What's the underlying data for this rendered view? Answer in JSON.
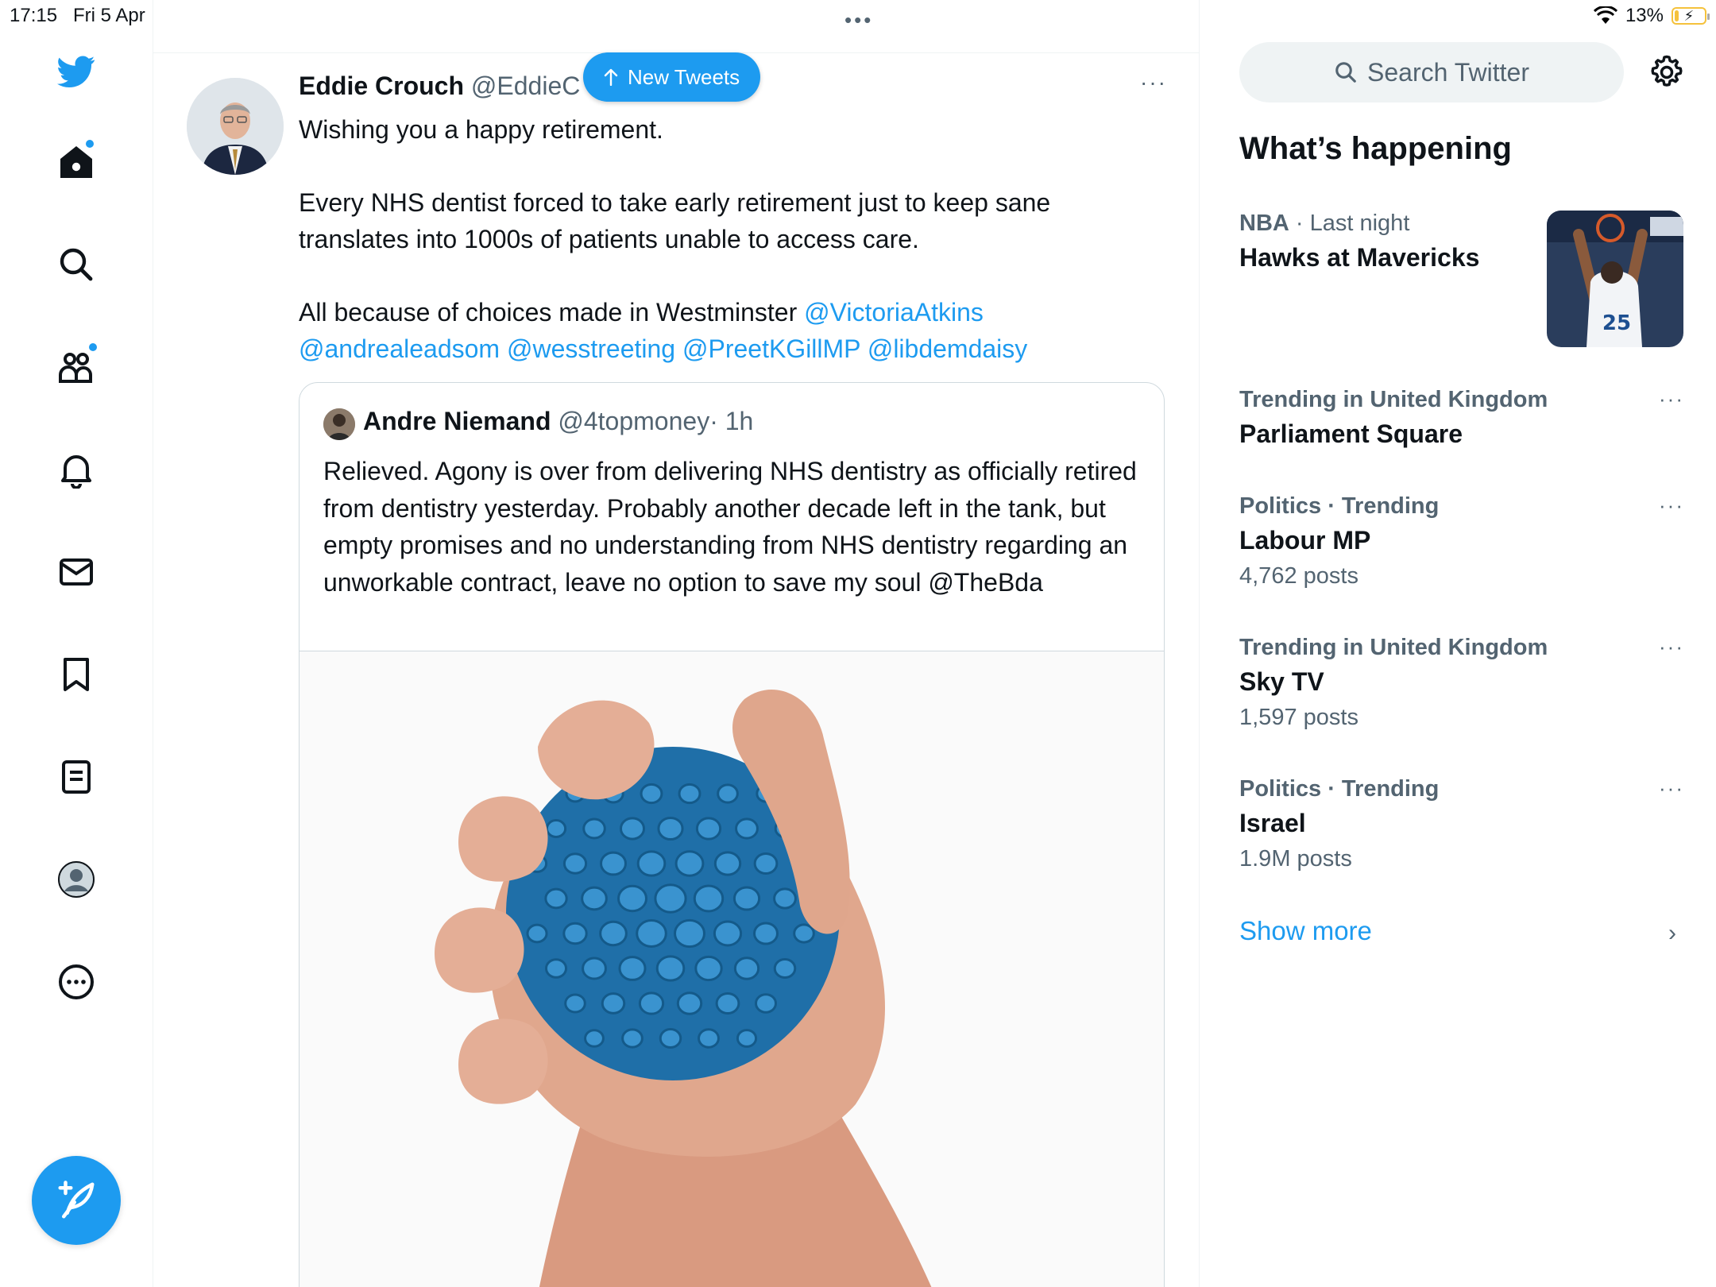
{
  "status": {
    "time": "17:15",
    "date": "Fri 5 Apr",
    "battery": "13%",
    "battery_level_pct": 13
  },
  "sidebar": {
    "items": [
      {
        "icon": "twitter-logo-icon"
      },
      {
        "icon": "home-icon",
        "has_dot": true
      },
      {
        "icon": "search-icon"
      },
      {
        "icon": "communities-icon",
        "has_dot": true
      },
      {
        "icon": "bell-icon"
      },
      {
        "icon": "mail-icon"
      },
      {
        "icon": "bookmark-icon"
      },
      {
        "icon": "lists-icon"
      },
      {
        "icon": "profile-icon"
      },
      {
        "icon": "more-circle-icon"
      }
    ],
    "compose_icon": "compose-feather-icon"
  },
  "main": {
    "top_more": "•••",
    "new_tweets_label": "New Tweets",
    "tweet": {
      "author_name": "Eddie Crouch",
      "author_handle": "@EddieC",
      "more": "···",
      "para1": "Wishing you a happy retirement.",
      "para2": "Every NHS dentist forced to take early retirement just to keep sane translates into 1000s of patients unable to access care.",
      "para3_text": "All because of choices made in Westminster ",
      "mentions": [
        "@VictoriaAtkins",
        "@andrealeadsom",
        "@wesstreeting",
        "@PreetKGillMP",
        "@libdemdaisy"
      ],
      "quote": {
        "author_name": "Andre Niemand",
        "author_handle": "@4topmoney",
        "time": "· 1h",
        "text": "Relieved. Agony is over from delivering NHS dentistry as officially retired from dentistry yesterday. Probably another decade left in the tank, but empty promises and no understanding from NHS dentistry regarding an unworkable contract, leave no option to save my soul @TheBda"
      }
    }
  },
  "right": {
    "search_placeholder": "Search Twitter",
    "section_title": "What’s happening",
    "trends": [
      {
        "category": "NBA",
        "context": " · Last night",
        "title": "Hawks at Mavericks",
        "count": ""
      },
      {
        "category": "Trending in United Kingdom",
        "context": "",
        "title": "Parliament Square",
        "count": ""
      },
      {
        "category": "Politics · Trending",
        "context": "",
        "title": "Labour MP",
        "count": "4,762 posts"
      },
      {
        "category": "Trending in United Kingdom",
        "context": "",
        "title": "Sky TV",
        "count": "1,597 posts"
      },
      {
        "category": "Politics · Trending",
        "context": "",
        "title": "Israel",
        "count": "1.9M posts"
      }
    ],
    "trend_more": "···",
    "show_more": "Show more",
    "show_more_chevron": "›"
  },
  "colors": {
    "accent": "#1d9bf0",
    "text": "#0f1419",
    "secondary": "#536471",
    "border": "#cfd9de"
  }
}
